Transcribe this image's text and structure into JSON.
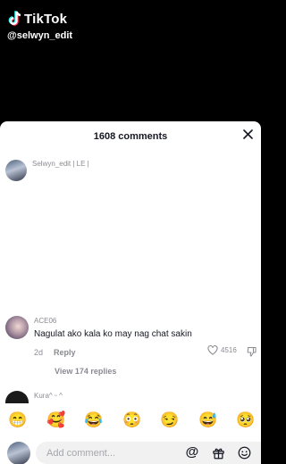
{
  "video": {
    "brand": "TikTok",
    "handle": "@selwyn_edit"
  },
  "sheet": {
    "title": "1608 comments"
  },
  "comments": [
    {
      "username": "Selwyn_edit | LE |"
    },
    {
      "username": "ACE06",
      "text": "Nagulat ako kala ko may nag chat sakin",
      "age": "2d",
      "reply_label": "Reply",
      "likes": "4516",
      "view_replies": "View 174 replies"
    },
    {
      "username": "Kura^ ᵕ ^"
    }
  ],
  "emoji_bar": [
    "😁",
    "🥰",
    "😂",
    "😳",
    "😏",
    "😅",
    "🥺"
  ],
  "input": {
    "placeholder": "Add comment...",
    "mention_symbol": "@"
  },
  "icons": [
    "tiktok-logo",
    "close-icon",
    "heart-icon",
    "dislike-icon",
    "mention-icon",
    "gift-icon",
    "emoji-icon"
  ]
}
